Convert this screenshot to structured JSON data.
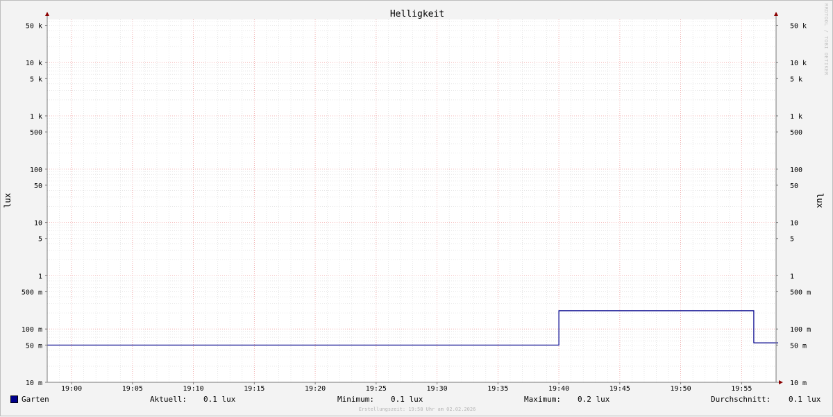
{
  "chart_data": {
    "type": "line",
    "title": "Helligkeit",
    "ylabel": "lux",
    "y_scale": "log",
    "ylim": [
      0.01,
      80000
    ],
    "y_tick_values": [
      0.01,
      0.05,
      0.1,
      0.5,
      1,
      5,
      10,
      50,
      100,
      500,
      1000,
      5000,
      10000,
      50000
    ],
    "y_tick_labels": [
      "10 m",
      "50 m",
      "100 m",
      "500 m",
      "1",
      "5",
      "10",
      "50",
      "100",
      "500",
      "1 k",
      "5 k",
      "10 k",
      "50 k"
    ],
    "x_tick_labels": [
      "19:00",
      "19:05",
      "19:10",
      "19:15",
      "19:20",
      "19:25",
      "19:30",
      "19:35",
      "19:40",
      "19:45",
      "19:50",
      "19:55"
    ],
    "xlim": [
      "18:58",
      "19:58"
    ],
    "series": [
      {
        "name": "Garten",
        "color": "#00008b",
        "x": [
          "18:58",
          "19:40",
          "19:40",
          "19:56",
          "19:56",
          "19:58"
        ],
        "y": [
          0.05,
          0.05,
          0.22,
          0.22,
          0.055,
          0.055
        ]
      }
    ],
    "grid": true,
    "legend": "bottom"
  },
  "legend": {
    "series_name": "Garten",
    "current_label": "Aktuell:",
    "current_value": "0.1 lux",
    "min_label": "Minimum:",
    "min_value": "0.1 lux",
    "max_label": "Maximum:",
    "max_value": "0.2 lux",
    "avg_label": "Durchschnitt:",
    "avg_value": "0.1 lux"
  },
  "footer": {
    "created": "Erstellungszeit: 19:58 Uhr am 02.02.2026"
  },
  "watermark": "RRDTOOL / TOBI OETIKER"
}
